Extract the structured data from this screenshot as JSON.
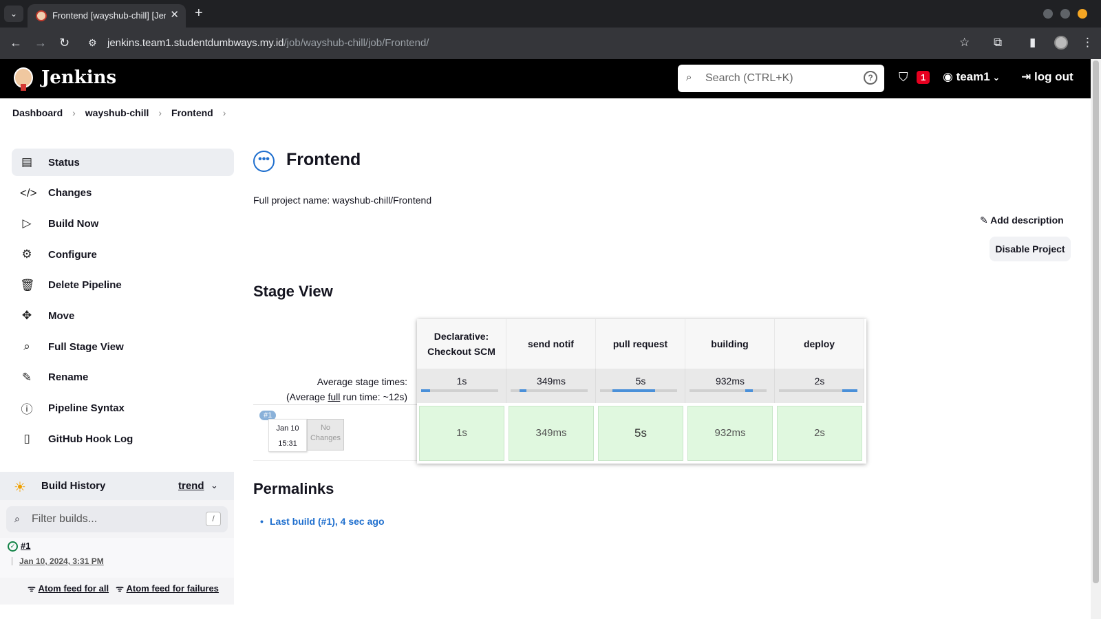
{
  "browser": {
    "tab_title": "Frontend [wayshub-chill] [Jenkins]",
    "url_host": "jenkins.team1.studentdumbways.my.id",
    "url_path": "/job/wayshub-chill/job/Frontend/"
  },
  "header": {
    "brand": "Jenkins",
    "search_placeholder": "Search (CTRL+K)",
    "alert_count": "1",
    "user": "team1",
    "logout": "log out"
  },
  "breadcrumb": [
    "Dashboard",
    "wayshub-chill",
    "Frontend"
  ],
  "sidebar": {
    "items": [
      {
        "label": "Status",
        "icon": "document-icon"
      },
      {
        "label": "Changes",
        "icon": "code-icon"
      },
      {
        "label": "Build Now",
        "icon": "play-icon"
      },
      {
        "label": "Configure",
        "icon": "gear-icon"
      },
      {
        "label": "Delete Pipeline",
        "icon": "trash-icon"
      },
      {
        "label": "Move",
        "icon": "move-icon"
      },
      {
        "label": "Full Stage View",
        "icon": "search-icon"
      },
      {
        "label": "Rename",
        "icon": "pencil-icon"
      },
      {
        "label": "Pipeline Syntax",
        "icon": "help-icon"
      },
      {
        "label": "GitHub Hook Log",
        "icon": "clipboard-icon"
      }
    ]
  },
  "build_history": {
    "title": "Build History",
    "trend": "trend",
    "filter_placeholder": "Filter builds...",
    "filter_shortcut": "/",
    "builds": [
      {
        "number": "#1",
        "date": "Jan 10, 2024, 3:31 PM",
        "status": "success"
      }
    ],
    "feed_all": "Atom feed for all",
    "feed_failures": "Atom feed for failures"
  },
  "main": {
    "title": "Frontend",
    "full_name": "Full project name: wayshub-chill/Frontend",
    "add_description": "Add description",
    "disable_project": "Disable Project",
    "stage_view_title": "Stage View",
    "avg_stage_times": "Average stage times:",
    "avg_full_prefix": "(Average ",
    "avg_full_word": "full",
    "avg_full_suffix": " run time: ~12s)",
    "stages": [
      {
        "name": "Declarative: Checkout SCM",
        "avg": "1s",
        "cell": "1s",
        "bar_fraction": 0.12
      },
      {
        "name": "send notif",
        "avg": "349ms",
        "cell": "349ms",
        "bar_fraction": 0.04
      },
      {
        "name": "pull request",
        "avg": "5s",
        "cell": "5s",
        "bar_fraction": 0.55
      },
      {
        "name": "building",
        "avg": "932ms",
        "cell": "932ms",
        "bar_fraction": 0.1
      },
      {
        "name": "deploy",
        "avg": "2s",
        "cell": "2s",
        "bar_fraction": 0.2
      }
    ],
    "run": {
      "number": "#1",
      "date": "Jan 10",
      "time": "15:31",
      "changes": "No Changes"
    },
    "permalinks_title": "Permalinks",
    "permalinks": [
      "Last build (#1), 4 sec ago"
    ]
  }
}
